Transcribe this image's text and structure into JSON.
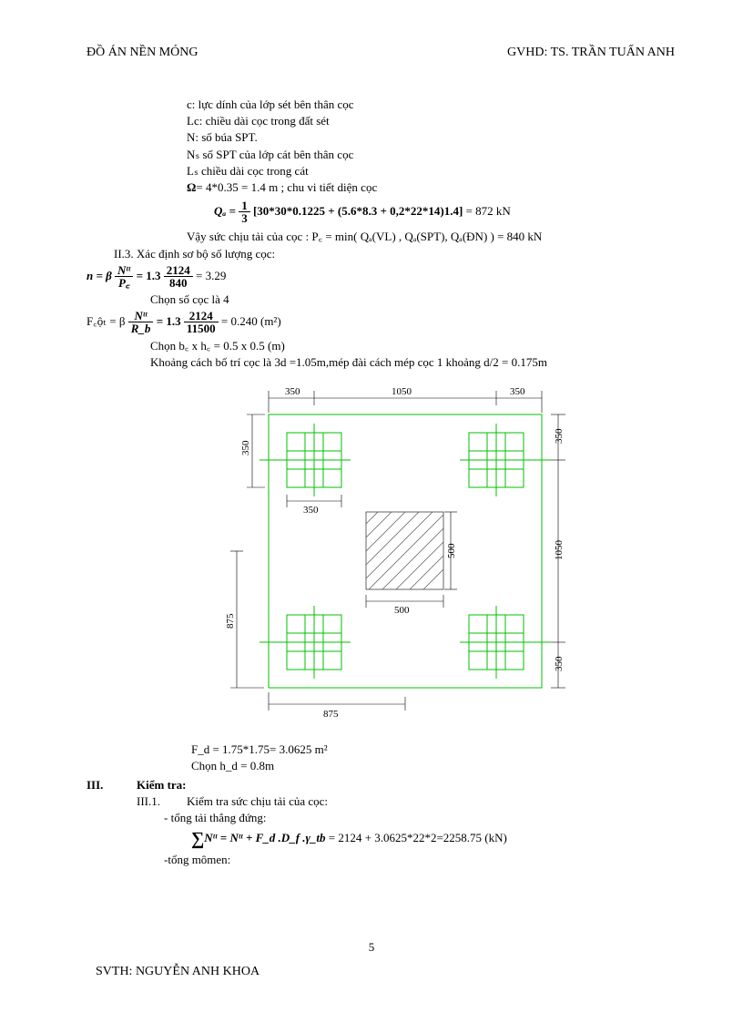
{
  "header": {
    "left": "ĐỒ ÁN NỀN MÓNG",
    "right": "GVHD: TS. TRẦN  TUẤN ANH"
  },
  "defs": {
    "c": "c: lực dính  của lớp sét bên thân cọc",
    "Lc": "Lc: chiều  dài cọc trong đất sét",
    "N": "N: số búa SPT.",
    "Ns": "Nₛ số SPT của lớp cát bên thân cọc",
    "Ls": "Lₛ  chiều dài cọc trong cát",
    "Omega": "= 4*0.35 = 1.4 m ; chu vi tiết diện cọc"
  },
  "Qa": {
    "left": "Qₐ =",
    "frac_num": "1",
    "frac_den": "3",
    "expr": "[30*30*0.1225 + (5.6*8.3 + 0,2*22*14)1.4]",
    "rhs": " = 872 kN"
  },
  "bearing_line": "Vậy sức chịu tải của cọc : P꜀ = min( Qₐ(VL) , Qₐ(SPT), Qₐ(ĐN) ) = 840 kN",
  "II3": "II.3. Xác định sơ bộ số lượng cọc:",
  "n_eq": {
    "pre": "n = β",
    "f1n": "Nᵗᵗ",
    "f1d": "P꜀",
    "mid": " = 1.3",
    "f2n": "2124",
    "f2d": "840",
    "rhs": " = 3.29"
  },
  "chon_so": "Chọn số cọc là 4",
  "F_eq": {
    "pre": "F꜀ộₜ = β",
    "f1n": "Nᵗᵗ",
    "f1d": "R_b",
    "mid": " = 1.3",
    "f2n": "2124",
    "f2d": "11500",
    "rhs": " = 0.240 (m²)"
  },
  "chon_bc": "Chọn b꜀ x h꜀ = 0.5 x 0.5 (m)",
  "spacing": "Khoảng cách bố trí cọc là 3d =1.05m,mép đài cách mép cọc 1 khoảng d/2 = 0.175m",
  "Fd": "F_d = 1.75*1.75= 3.0625 m²",
  "chon_hd": "Chọn h_d = 0.8m",
  "III": "Kiểm tra:",
  "III_num": "III.",
  "III1": "Kiểm tra sức chịu tải của cọc:",
  "III1_num": "III.1.",
  "tong_tai": "- tổng tải thẳng đứng:",
  "sumN": {
    "lhs": "Nᵗᵗ = Nᵗᵗ + F_d .D_f .γ_tb",
    "rhs": " = 2124 + 3.0625*22*2=2258.75 (kN)"
  },
  "tong_mom": "-tổng mômen:",
  "dims": {
    "t350a": "350",
    "t1050": "1050",
    "t350b": "350",
    "l350": "350",
    "inner350": "350",
    "r350a": "350",
    "r1050": "1050",
    "r350b": "350",
    "c500v": "500",
    "c500h": "500",
    "l875": "875",
    "b875": "875"
  },
  "page_no": "5",
  "author": "SVTH: NGUYỄN ANH KHOA"
}
